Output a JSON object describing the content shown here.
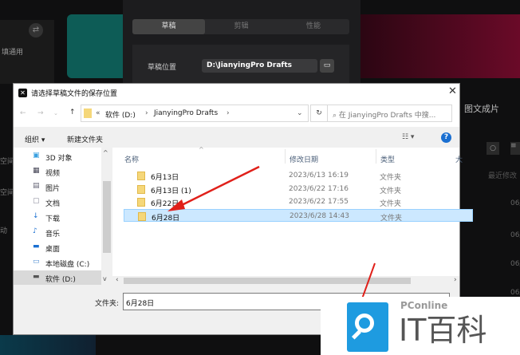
{
  "background": {
    "left_text": "填通用",
    "left_texts": [
      "空间",
      "空间",
      "动"
    ],
    "tabs": [
      "草稿",
      "剪辑",
      "性能"
    ],
    "draft_location_label": "草稿位置",
    "draft_location_value": "D:\\JianyingPro Drafts",
    "right_title": "图文成片",
    "right_sub": "最近修改",
    "dates": [
      "06/",
      "06/",
      "06/",
      "06/"
    ]
  },
  "dialog": {
    "title": "请选择草稿文件的保存位置",
    "breadcrumb": [
      "«",
      "软件 (D:)",
      "JianyingPro Drafts"
    ],
    "search_placeholder": "在 JianyingPro Drafts 中搜...",
    "organize": "组织 ▾",
    "new_folder": "新建文件夹",
    "help": "?",
    "sidebar": [
      "3D 对象",
      "视频",
      "图片",
      "文档",
      "下载",
      "音乐",
      "桌面",
      "本地磁盘 (C:)",
      "软件 (D:)"
    ],
    "columns": [
      "名称",
      "修改日期",
      "类型",
      "大"
    ],
    "rows": [
      {
        "name": "6月13日",
        "date": "2023/6/13 16:19",
        "type": "文件夹"
      },
      {
        "name": "6月13日 (1)",
        "date": "2023/6/22 17:16",
        "type": "文件夹"
      },
      {
        "name": "6月22日",
        "date": "2023/6/22 17:55",
        "type": "文件夹"
      },
      {
        "name": "6月28日",
        "date": "2023/6/28 14:43",
        "type": "文件夹"
      }
    ],
    "folder_label": "文件夹:",
    "folder_value": "6月28日"
  },
  "watermark": {
    "brand": "PConline",
    "name": "IT百科"
  }
}
